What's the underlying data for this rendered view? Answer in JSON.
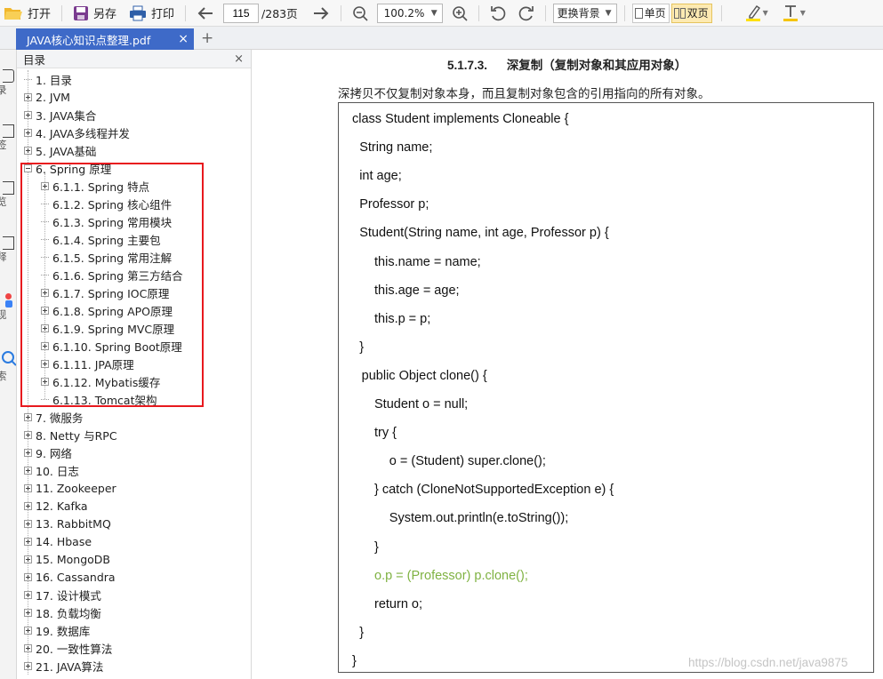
{
  "toolbar": {
    "open": "打开",
    "save_as": "另存",
    "print": "打印",
    "page_current": "115",
    "page_total": "/283页",
    "zoom": "100.2%",
    "background": "更换背景",
    "single_page": "单页",
    "double_page": "双页",
    "highlight_color": "#ffe000",
    "text_color": "#f5c400",
    "accent": "#3e6ac8"
  },
  "tabs": [
    {
      "label": "JAVA核心知识点整理.pdf"
    }
  ],
  "leftbar": {
    "items": [
      "录",
      "签",
      "览",
      "释",
      "现",
      "索"
    ]
  },
  "toc_panel": {
    "title": "目录",
    "items": [
      {
        "label": "1. 目录",
        "level": 0,
        "expander": "none"
      },
      {
        "label": "2. JVM",
        "level": 0,
        "expander": "plus"
      },
      {
        "label": "3. JAVA集合",
        "level": 0,
        "expander": "plus"
      },
      {
        "label": "4. JAVA多线程并发",
        "level": 0,
        "expander": "plus"
      },
      {
        "label": "5. JAVA基础",
        "level": 0,
        "expander": "plus"
      },
      {
        "label": "6. Spring 原理",
        "level": 0,
        "expander": "minus"
      },
      {
        "label": "6.1.1. Spring 特点",
        "level": 1,
        "expander": "plus"
      },
      {
        "label": "6.1.2. Spring 核心组件",
        "level": 1,
        "expander": "none"
      },
      {
        "label": "6.1.3. Spring 常用模块",
        "level": 1,
        "expander": "none"
      },
      {
        "label": "6.1.4. Spring 主要包",
        "level": 1,
        "expander": "none"
      },
      {
        "label": "6.1.5. Spring 常用注解",
        "level": 1,
        "expander": "none"
      },
      {
        "label": "6.1.6. Spring 第三方结合",
        "level": 1,
        "expander": "none"
      },
      {
        "label": "6.1.7. Spring IOC原理",
        "level": 1,
        "expander": "plus"
      },
      {
        "label": "6.1.8. Spring APO原理",
        "level": 1,
        "expander": "plus"
      },
      {
        "label": "6.1.9. Spring MVC原理",
        "level": 1,
        "expander": "plus"
      },
      {
        "label": "6.1.10. Spring Boot原理",
        "level": 1,
        "expander": "plus"
      },
      {
        "label": "6.1.11. JPA原理",
        "level": 1,
        "expander": "plus"
      },
      {
        "label": "6.1.12. Mybatis缓存",
        "level": 1,
        "expander": "plus"
      },
      {
        "label": "6.1.13. Tomcat架构",
        "level": 1,
        "expander": "none"
      },
      {
        "label": "7. 微服务",
        "level": 0,
        "expander": "plus"
      },
      {
        "label": "8. Netty 与RPC",
        "level": 0,
        "expander": "plus"
      },
      {
        "label": "9. 网络",
        "level": 0,
        "expander": "plus"
      },
      {
        "label": "10. 日志",
        "level": 0,
        "expander": "plus"
      },
      {
        "label": "11. Zookeeper",
        "level": 0,
        "expander": "plus"
      },
      {
        "label": "12. Kafka",
        "level": 0,
        "expander": "plus"
      },
      {
        "label": "13. RabbitMQ",
        "level": 0,
        "expander": "plus"
      },
      {
        "label": "14. Hbase",
        "level": 0,
        "expander": "plus"
      },
      {
        "label": "15. MongoDB",
        "level": 0,
        "expander": "plus"
      },
      {
        "label": "16. Cassandra",
        "level": 0,
        "expander": "plus"
      },
      {
        "label": "17. 设计模式",
        "level": 0,
        "expander": "plus"
      },
      {
        "label": "18. 负载均衡",
        "level": 0,
        "expander": "plus"
      },
      {
        "label": "19. 数据库",
        "level": 0,
        "expander": "plus"
      },
      {
        "label": "20. 一致性算法",
        "level": 0,
        "expander": "plus"
      },
      {
        "label": "21. JAVA算法",
        "level": 0,
        "expander": "plus"
      }
    ]
  },
  "document": {
    "section_number": "5.1.7.3.",
    "section_title": "深复制（复制对象和其应用对象）",
    "paragraph": "深拷贝不仅复制对象本身，而且复制对象包含的引用指向的所有对象。",
    "code_lines": [
      {
        "text": "class Student implements Cloneable {",
        "indent": 0,
        "color": "#111111"
      },
      {
        "text": "String name;",
        "indent": 1,
        "color": "#111111"
      },
      {
        "text": "int age;",
        "indent": 1,
        "color": "#111111"
      },
      {
        "text": "Professor p;",
        "indent": 1,
        "color": "#111111"
      },
      {
        "text": "Student(String name, int age, Professor p) {",
        "indent": 1,
        "color": "#111111"
      },
      {
        "text": "this.name = name;",
        "indent": 2,
        "color": "#111111"
      },
      {
        "text": "this.age = age;",
        "indent": 2,
        "color": "#111111"
      },
      {
        "text": "this.p = p;",
        "indent": 2,
        "color": "#111111"
      },
      {
        "text": "}",
        "indent": 1,
        "color": "#111111"
      },
      {
        "text": "public Object clone() {",
        "indent": 1.3,
        "color": "#111111"
      },
      {
        "text": "Student o = null;",
        "indent": 2,
        "color": "#111111"
      },
      {
        "text": "try {",
        "indent": 2,
        "color": "#111111"
      },
      {
        "text": "o = (Student) super.clone();",
        "indent": 3,
        "color": "#111111"
      },
      {
        "text": "} catch (CloneNotSupportedException e) {",
        "indent": 2,
        "color": "#111111"
      },
      {
        "text": "System.out.println(e.toString());",
        "indent": 3,
        "color": "#111111"
      },
      {
        "text": "}",
        "indent": 2,
        "color": "#111111"
      },
      {
        "text": "o.p = (Professor) p.clone();",
        "indent": 2,
        "color": "#7fb242"
      },
      {
        "text": "return o;",
        "indent": 2,
        "color": "#111111"
      },
      {
        "text": "}",
        "indent": 1,
        "color": "#111111"
      },
      {
        "text": "}",
        "indent": 0,
        "color": "#111111"
      }
    ],
    "watermark": "https://blog.csdn.net/java9875"
  }
}
